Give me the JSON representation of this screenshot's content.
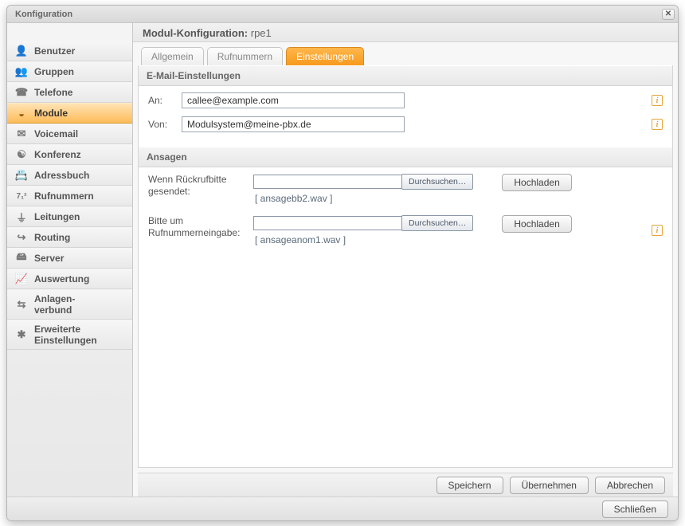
{
  "window": {
    "title": "Konfiguration"
  },
  "sidebar": {
    "items": [
      {
        "label": "Benutzer",
        "icon": "person-icon"
      },
      {
        "label": "Gruppen",
        "icon": "group-icon"
      },
      {
        "label": "Telefone",
        "icon": "phone-icon"
      },
      {
        "label": "Module",
        "icon": "module-icon"
      },
      {
        "label": "Voicemail",
        "icon": "voicemail-icon"
      },
      {
        "label": "Konferenz",
        "icon": "conference-icon"
      },
      {
        "label": "Adressbuch",
        "icon": "addressbook-icon"
      },
      {
        "label": "Rufnummern",
        "icon": "numbers-icon"
      },
      {
        "label": "Leitungen",
        "icon": "lines-icon"
      },
      {
        "label": "Routing",
        "icon": "routing-icon"
      },
      {
        "label": "Server",
        "icon": "server-icon"
      },
      {
        "label": "Auswertung",
        "icon": "reporting-icon"
      },
      {
        "label": "Anlagen-\nverbund",
        "icon": "cluster-icon"
      },
      {
        "label": "Erweiterte\nEinstellungen",
        "icon": "advanced-icon"
      }
    ]
  },
  "main": {
    "header_prefix": "Modul-Konfiguration: ",
    "header_name": "rpe1"
  },
  "tabs": [
    {
      "label": "Allgemein"
    },
    {
      "label": "Rufnummern"
    },
    {
      "label": "Einstellungen"
    }
  ],
  "email": {
    "section_title": "E-Mail-Einstellungen",
    "to_label": "An:",
    "to_value": "callee@example.com",
    "from_label": "Von:",
    "from_value": "Modulsystem@meine-pbx.de"
  },
  "announce": {
    "section_title": "Ansagen",
    "row1_label": "Wenn Rückrufbitte gesendet:",
    "row1_file": "[ ansagebb2.wav ]",
    "row2_label": "Bitte um Rufnummerneingabe:",
    "row2_file": "[ ansageanom1.wav ]",
    "browse_label": "Durchsuchen…",
    "upload_label": "Hochladen"
  },
  "buttons": {
    "save": "Speichern",
    "apply": "Übernehmen",
    "cancel": "Abbrechen",
    "close": "Schließen"
  }
}
